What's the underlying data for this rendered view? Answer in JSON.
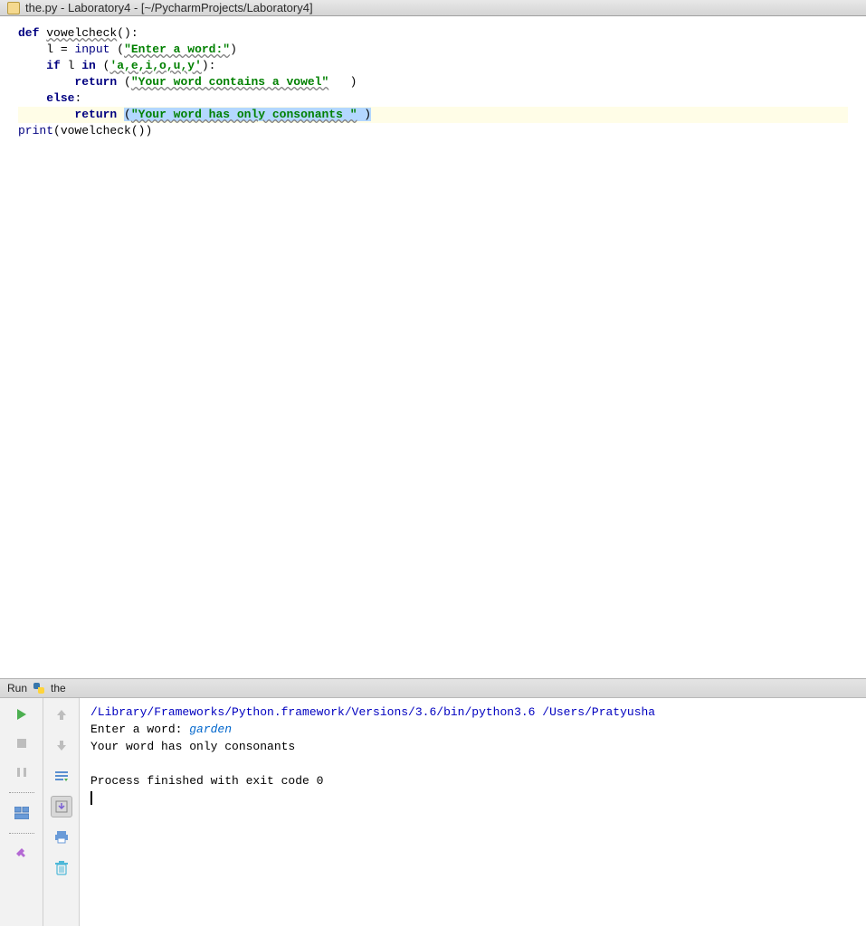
{
  "titlebar": {
    "text": "the.py - Laboratory4 - [~/PycharmProjects/Laboratory4]"
  },
  "code": {
    "def": "def",
    "fn_name": "vowelcheck",
    "paren_colon": "():",
    "l1_var": "l",
    "l1_eq": " = ",
    "l1_input": "input",
    "l1_open": " (",
    "l1_str": "\"Enter a word:\"",
    "l1_close": ")",
    "if_kw": "if",
    "if_var": " l ",
    "in_kw": "in",
    "if_tuple_open": " (",
    "if_str": "'a,e,i,o,u,y'",
    "if_tuple_close": "):",
    "ret1_kw": "return",
    "ret1_open": " (",
    "ret1_str": "\"Your word contains a vowel\"",
    "ret1_close": "   )",
    "else_kw": "else",
    "else_colon": ":",
    "ret2_kw": "return",
    "ret2_space": " ",
    "ret2_open": "(",
    "ret2_str": "\"Your word has only consonants \"",
    "ret2_close": " )",
    "print_kw": "print",
    "print_open": "(",
    "print_call": "vowelcheck",
    "print_close": "())"
  },
  "run_panel": {
    "label": "Run",
    "config": "the"
  },
  "console": {
    "path": "/Library/Frameworks/Python.framework/Versions/3.6/bin/python3.6 /Users/Pratyusha",
    "prompt": "Enter a word: ",
    "user_input": "garden",
    "output": "Your word has only consonants ",
    "blank": "",
    "exit": "Process finished with exit code 0"
  }
}
